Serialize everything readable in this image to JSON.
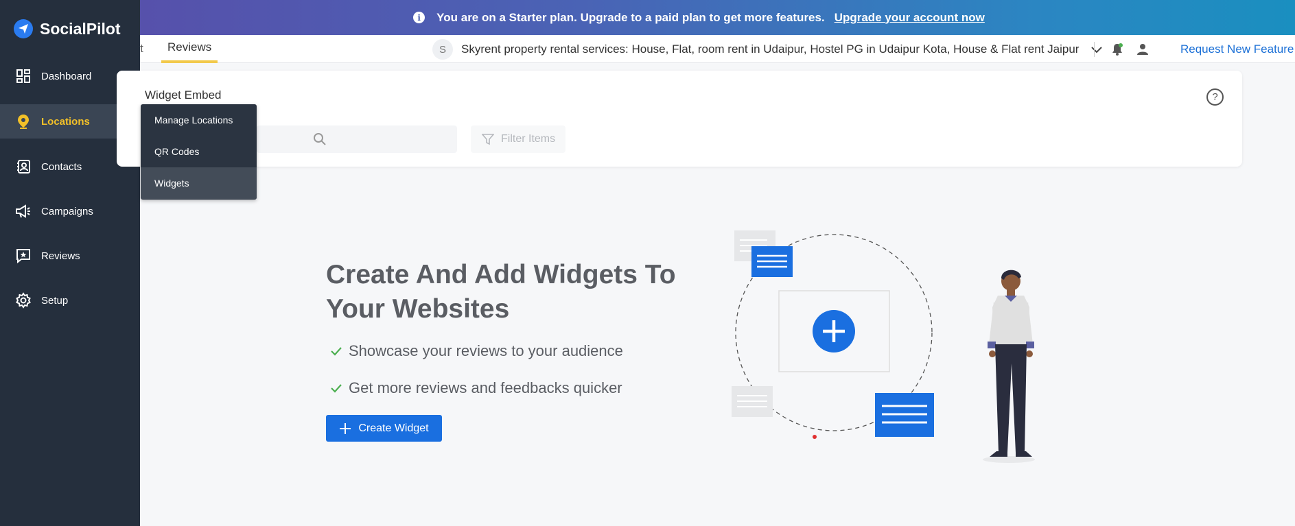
{
  "banner": {
    "message": "You are on a Starter plan. Upgrade to a paid plan to get more features.",
    "link": "Upgrade your account now",
    "info_icon": "i"
  },
  "brand": {
    "name": "SocialPilot"
  },
  "sidebar": {
    "items": [
      {
        "label": "Dashboard",
        "icon": "dashboard-icon"
      },
      {
        "label": "Locations",
        "icon": "location-pin-icon",
        "active": true
      },
      {
        "label": "Contacts",
        "icon": "contacts-icon"
      },
      {
        "label": "Campaigns",
        "icon": "megaphone-icon"
      },
      {
        "label": "Reviews",
        "icon": "review-star-icon"
      },
      {
        "label": "Setup",
        "icon": "gear-icon"
      }
    ]
  },
  "flyout": {
    "items": [
      {
        "label": "Manage Locations"
      },
      {
        "label": "QR Codes"
      },
      {
        "label": "Widgets",
        "active": true
      }
    ]
  },
  "header": {
    "tab_partial": "t",
    "tab_active": "Reviews",
    "location_initial": "S",
    "location_name": "Skyrent property rental services: House, Flat, room rent in Udaipur, Hostel PG in Udaipur Kota, House & Flat rent Jaipur",
    "request_feature": "Request New Feature"
  },
  "card": {
    "title": "Widget Embed",
    "help": "?",
    "search_value": "",
    "filter_placeholder": "Filter Items"
  },
  "hero": {
    "title": "Create And Add Widgets To Your Websites",
    "bullets": [
      "Showcase your reviews to your audience",
      "Get more reviews and feedbacks quicker"
    ],
    "button": "Create Widget"
  },
  "colors": {
    "accent": "#1a6fe0",
    "sidebar_bg": "#252f3d",
    "active_nav": "#f2c028",
    "tab_underline": "#f2c94c",
    "check": "#4caf50"
  }
}
